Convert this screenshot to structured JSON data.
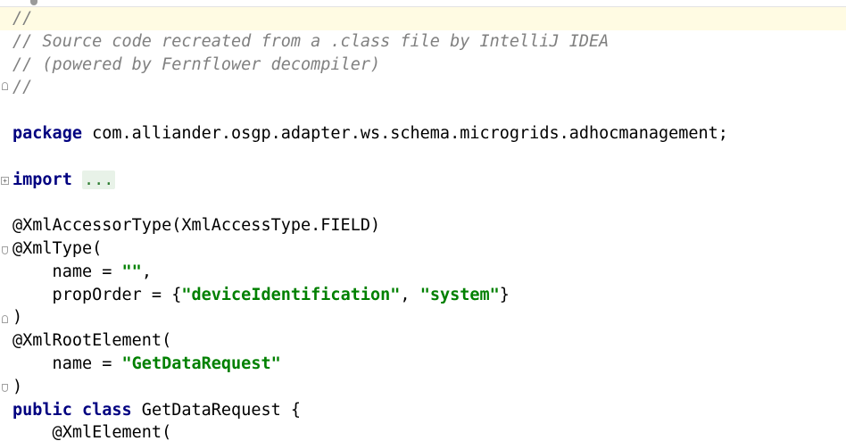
{
  "editor": {
    "lines": {
      "l1": "//",
      "l2": "// Source code recreated from a .class file by IntelliJ IDEA",
      "l3": "// (powered by Fernflower decompiler)",
      "l4": "//",
      "l5": "",
      "l6_kw": "package",
      "l6_rest": " com.alliander.osgp.adapter.ws.schema.microgrids.adhocmanagement;",
      "l7": "",
      "l8_kw": "import",
      "l8_fold": "...",
      "l9": "",
      "l10": "@XmlAccessorType(XmlAccessType.FIELD)",
      "l11": "@XmlType(",
      "l12_pre": "    name = ",
      "l12_str": "\"\"",
      "l12_post": ",",
      "l13_pre": "    propOrder = {",
      "l13_str1": "\"deviceIdentification\"",
      "l13_mid": ", ",
      "l13_str2": "\"system\"",
      "l13_post": "}",
      "l14": ")",
      "l15": "@XmlRootElement(",
      "l16_pre": "    name = ",
      "l16_str": "\"GetDataRequest\"",
      "l17": ")",
      "l18_kw1": "public",
      "l18_sp": " ",
      "l18_kw2": "class",
      "l18_rest": " GetDataRequest {",
      "l19": "    @XmlElement("
    },
    "colors": {
      "keyword": "#000080",
      "string": "#008000",
      "comment": "#808080",
      "current_line": "#fffbe3"
    }
  }
}
